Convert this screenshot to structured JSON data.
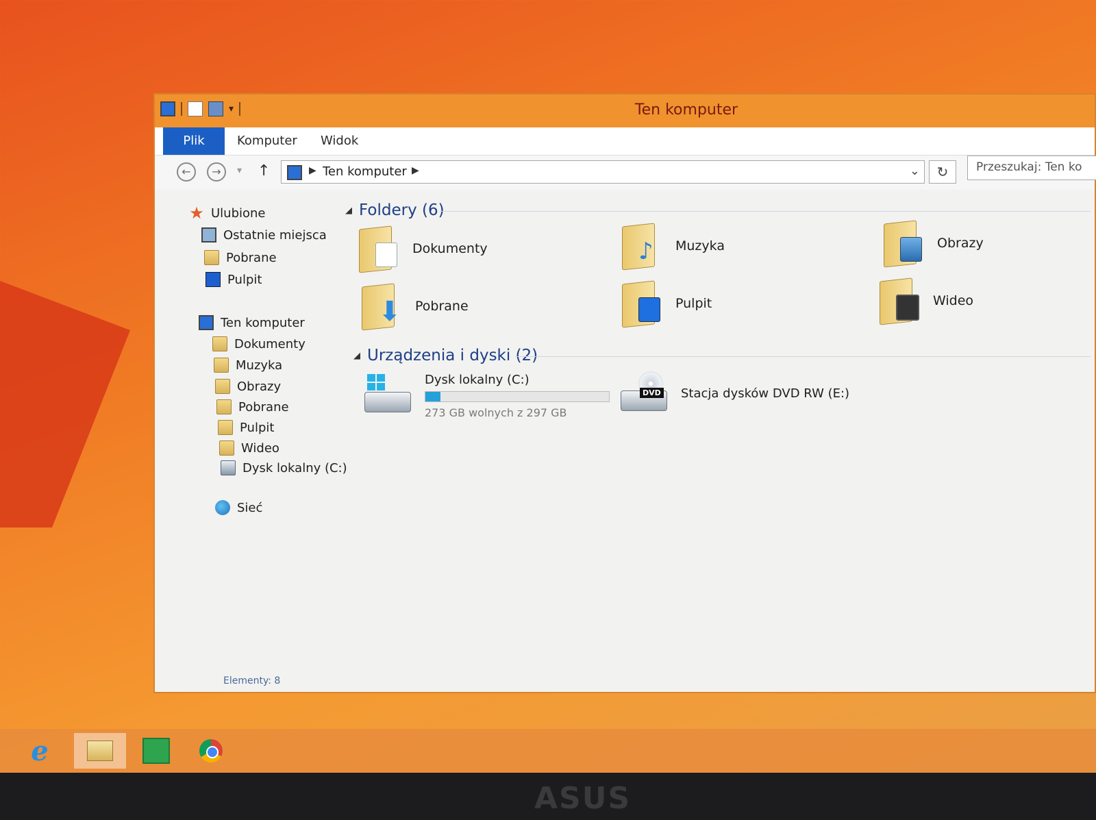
{
  "window": {
    "title": "Ten komputer"
  },
  "ribbon": {
    "tabs": [
      "Plik",
      "Komputer",
      "Widok"
    ]
  },
  "address": {
    "breadcrumb": "Ten komputer",
    "search_placeholder": "Przeszukaj: Ten ko"
  },
  "sidebar": {
    "favorites_header": "Ulubione",
    "favorites": [
      "Ostatnie miejsca",
      "Pobrane",
      "Pulpit"
    ],
    "this_pc": "Ten komputer",
    "pc_items": [
      "Dokumenty",
      "Muzyka",
      "Obrazy",
      "Pobrane",
      "Pulpit",
      "Wideo",
      "Dysk lokalny (C:)"
    ],
    "network": "Sieć"
  },
  "content": {
    "folders_header": "Foldery (6)",
    "folders": [
      "Dokumenty",
      "Muzyka",
      "Obrazy",
      "Pobrane",
      "Pulpit",
      "Wideo"
    ],
    "devices_header": "Urządzenia i dyski (2)",
    "drives": [
      {
        "name": "Dysk lokalny (C:)",
        "space": "273 GB wolnych z 297 GB",
        "used_fraction": 0.081
      },
      {
        "name": "Stacja dysków DVD RW (E:)"
      }
    ]
  },
  "status": {
    "items": "Elementy: 8"
  },
  "brand": "ASUS",
  "icons": {
    "dvd_label": "DVD"
  },
  "colors": {
    "title_bar": "#f0922e",
    "file_tab": "#1c5fc4",
    "group_header": "#1e3f88",
    "drive_fill": "#26a0da"
  }
}
